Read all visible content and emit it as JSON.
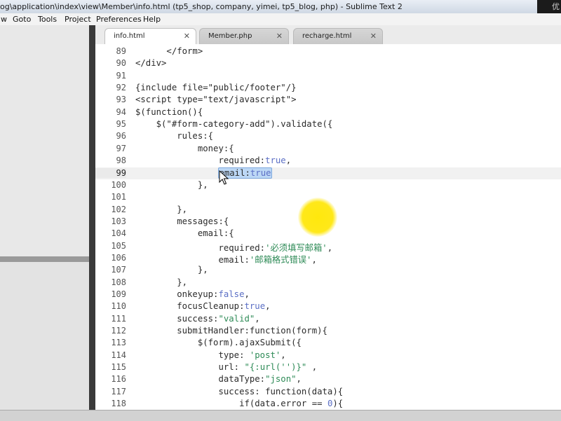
{
  "window": {
    "title": "og\\application\\index\\view\\Member\\info.html (tp5_shop, company, yimei, tp5_blog, php) - Sublime Text 2",
    "watermark": "优"
  },
  "menu": [
    "w",
    "Goto",
    "Tools",
    "Project",
    "Preferences",
    "Help"
  ],
  "tabs": [
    {
      "label": "info.html",
      "active": true
    },
    {
      "label": "Member.php",
      "active": false
    },
    {
      "label": "recharge.html",
      "active": false
    }
  ],
  "editor": {
    "current_line": 99,
    "lines": [
      {
        "n": "89",
        "code": [
          {
            "t": "      </form>"
          }
        ]
      },
      {
        "n": "90",
        "code": [
          {
            "t": "</div>"
          }
        ]
      },
      {
        "n": "91",
        "code": []
      },
      {
        "n": "92",
        "code": [
          {
            "t": "{include file=\"public/footer\"/}"
          }
        ]
      },
      {
        "n": "93",
        "code": [
          {
            "t": "<script type=\"text/javascript\">"
          }
        ]
      },
      {
        "n": "94",
        "code": [
          {
            "t": "$(function(){"
          }
        ]
      },
      {
        "n": "95",
        "code": [
          {
            "t": "    $(\"#form-category-add\").validate({"
          }
        ]
      },
      {
        "n": "96",
        "code": [
          {
            "t": "        rules:{"
          }
        ]
      },
      {
        "n": "97",
        "code": [
          {
            "t": "            money:{"
          }
        ]
      },
      {
        "n": "98",
        "code": [
          {
            "t": "                required:"
          },
          {
            "t": "true",
            "c": "bool"
          },
          {
            "t": ","
          }
        ]
      },
      {
        "n": "99",
        "code": [
          {
            "t": "                "
          },
          {
            "t": "email:true",
            "c": "sel"
          }
        ]
      },
      {
        "n": "100",
        "code": [
          {
            "t": "            },"
          }
        ]
      },
      {
        "n": "101",
        "code": []
      },
      {
        "n": "102",
        "code": [
          {
            "t": "        },"
          }
        ]
      },
      {
        "n": "103",
        "code": [
          {
            "t": "        messages:{"
          }
        ]
      },
      {
        "n": "104",
        "code": [
          {
            "t": "            email:{"
          }
        ]
      },
      {
        "n": "105",
        "code": [
          {
            "t": "                required:"
          },
          {
            "t": "'必须填写邮箱'",
            "c": "str"
          },
          {
            "t": ","
          }
        ]
      },
      {
        "n": "106",
        "code": [
          {
            "t": "                email:"
          },
          {
            "t": "'邮箱格式错误'",
            "c": "str"
          },
          {
            "t": ","
          }
        ]
      },
      {
        "n": "107",
        "code": [
          {
            "t": "            },"
          }
        ]
      },
      {
        "n": "108",
        "code": [
          {
            "t": "        },"
          }
        ]
      },
      {
        "n": "109",
        "code": [
          {
            "t": "        onkeyup:"
          },
          {
            "t": "false",
            "c": "bool"
          },
          {
            "t": ","
          }
        ]
      },
      {
        "n": "110",
        "code": [
          {
            "t": "        focusCleanup:"
          },
          {
            "t": "true",
            "c": "bool"
          },
          {
            "t": ","
          }
        ]
      },
      {
        "n": "111",
        "code": [
          {
            "t": "        success:"
          },
          {
            "t": "\"valid\"",
            "c": "str"
          },
          {
            "t": ","
          }
        ]
      },
      {
        "n": "112",
        "code": [
          {
            "t": "        submitHandler:function(form){"
          }
        ]
      },
      {
        "n": "113",
        "code": [
          {
            "t": "            $(form).ajaxSubmit({"
          }
        ]
      },
      {
        "n": "114",
        "code": [
          {
            "t": "                type: "
          },
          {
            "t": "'post'",
            "c": "str"
          },
          {
            "t": ","
          }
        ]
      },
      {
        "n": "115",
        "code": [
          {
            "t": "                url: "
          },
          {
            "t": "\"{:url('')}\"",
            "c": "str"
          },
          {
            "t": " ,"
          }
        ]
      },
      {
        "n": "116",
        "code": [
          {
            "t": "                dataType:"
          },
          {
            "t": "\"json\"",
            "c": "str"
          },
          {
            "t": ","
          }
        ]
      },
      {
        "n": "117",
        "code": [
          {
            "t": "                success: function(data){"
          }
        ]
      },
      {
        "n": "118",
        "code": [
          {
            "t": "                    if(data.error == "
          },
          {
            "t": "0",
            "c": "num"
          },
          {
            "t": "){"
          }
        ]
      }
    ]
  }
}
